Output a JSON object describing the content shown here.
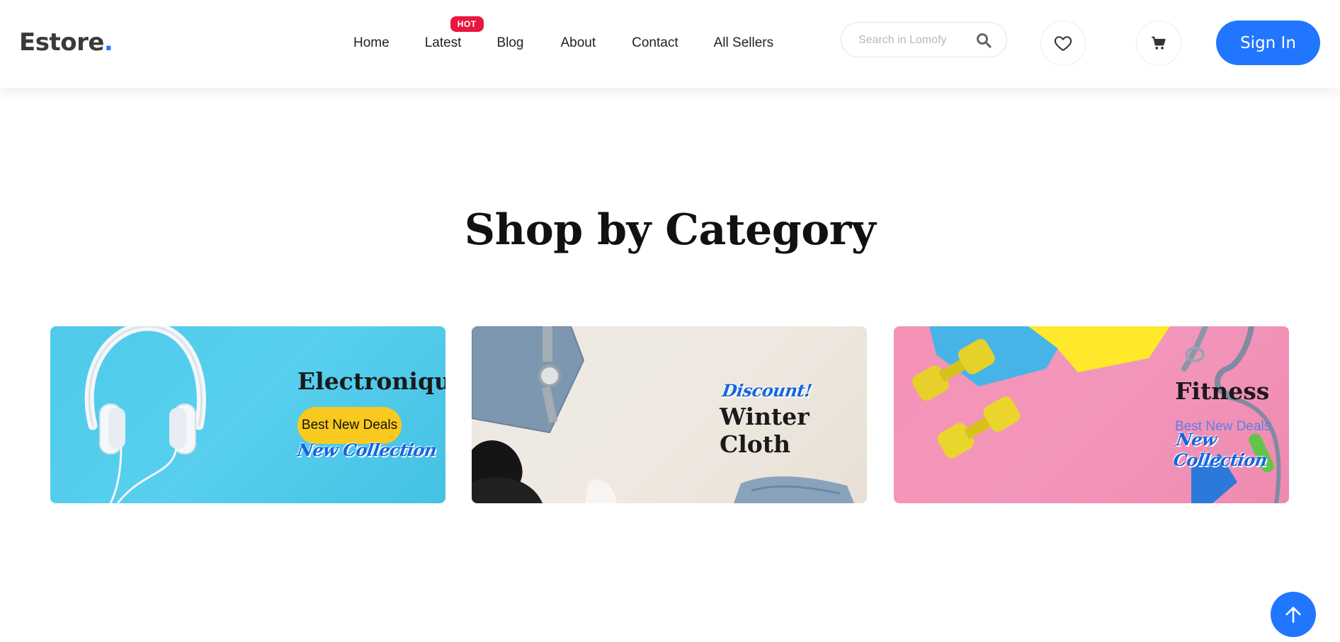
{
  "header": {
    "logo_text": "Estore",
    "logo_dot": ".",
    "nav": [
      {
        "label": "Home"
      },
      {
        "label": "Latest",
        "badge": "HOT"
      },
      {
        "label": "Blog"
      },
      {
        "label": "About"
      },
      {
        "label": "Contact"
      },
      {
        "label": "All Sellers"
      }
    ],
    "search": {
      "placeholder": "Search in Lomofy",
      "value": ""
    },
    "signin_label": "Sign In"
  },
  "section": {
    "title": "Shop by Category"
  },
  "categories": [
    {
      "title": "Electronique",
      "deal": "Best New Deals",
      "script": "New Collection"
    },
    {
      "title": "Winter Cloth",
      "script": "Discount!"
    },
    {
      "title": "Fitness",
      "deal": "Best New Deals",
      "script": "New Collection"
    }
  ],
  "colors": {
    "accent": "#2176ff",
    "hot_badge": "#e8173f",
    "deal_pill": "#f9c91d",
    "card_electronique": "#4fcaea",
    "card_winter": "#ece9e3",
    "card_fitness": "#f592b6"
  },
  "icons": {
    "search": "search-icon",
    "wishlist": "heart-icon",
    "cart": "cart-icon",
    "scroll_top": "arrow-up-icon"
  }
}
